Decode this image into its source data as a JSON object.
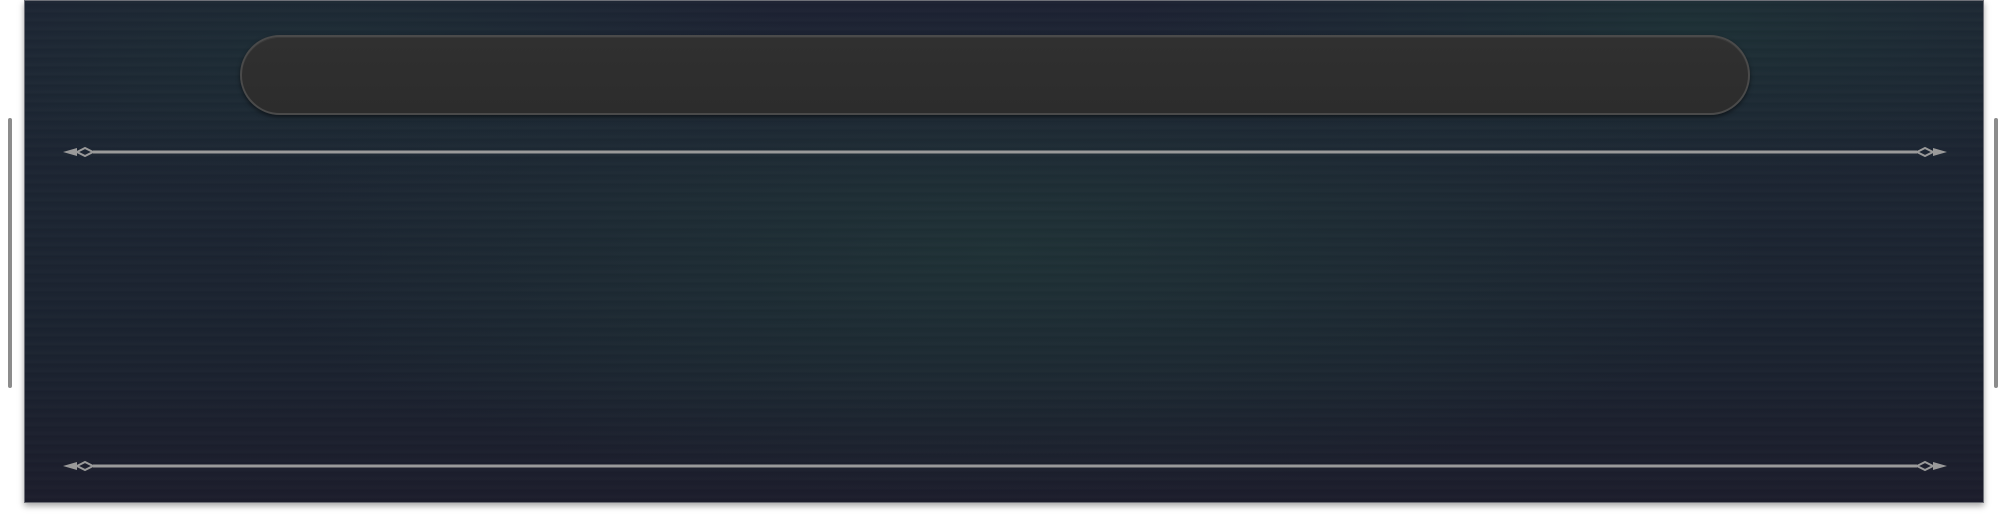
{
  "window": {
    "title": ""
  },
  "title_bar": {
    "text": ""
  },
  "icons": {
    "left_ornament": "ornament-arrow-left-icon",
    "right_ornament": "ornament-arrow-right-icon"
  },
  "colors": {
    "panel_background": "#1c2532",
    "pill_background": "#2e2e2e",
    "divider": "#9a9a9a",
    "scrollbar": "#8c8c8c"
  }
}
